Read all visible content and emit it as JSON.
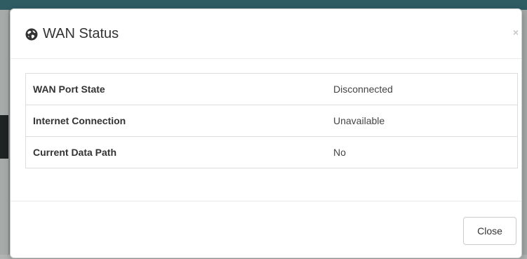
{
  "modal": {
    "title": "WAN Status",
    "title_icon": "globe-icon",
    "close_icon": "close-icon",
    "close_glyph": "×",
    "close_button_label": "Close"
  },
  "status_rows": [
    {
      "label": "WAN Port State",
      "value": "Disconnected"
    },
    {
      "label": "Internet Connection",
      "value": "Unavailable"
    },
    {
      "label": "Current Data Path",
      "value": "No"
    }
  ],
  "colors": {
    "top_bar": "#2f5b63",
    "backdrop": "#8a8f8d",
    "modal_bg": "#ffffff"
  }
}
